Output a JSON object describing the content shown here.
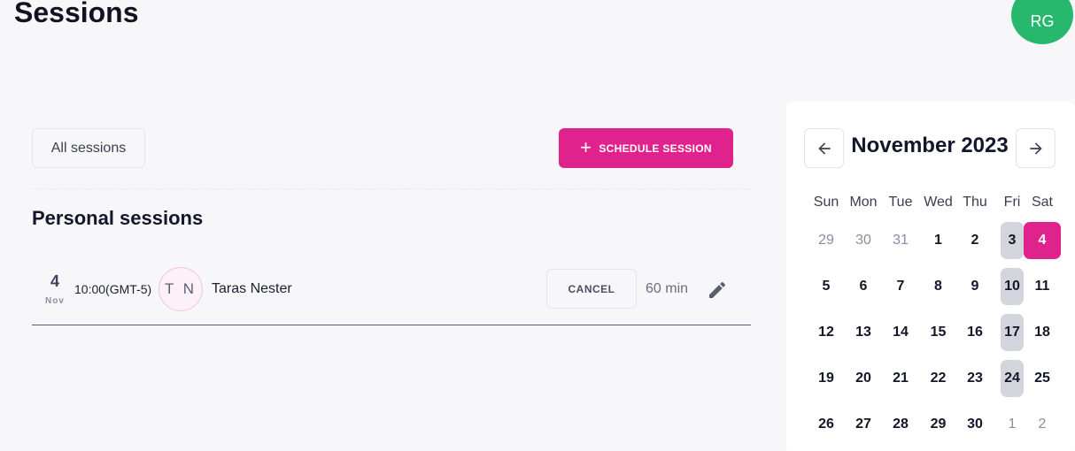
{
  "header": {
    "title": "Sessions",
    "user_initials": "RG"
  },
  "toolbar": {
    "filter_label": "All sessions",
    "schedule_label": "SCHEDULE SESSION"
  },
  "section": {
    "title": "Personal sessions"
  },
  "session": {
    "day": "4",
    "month": "Nov",
    "time": "10:00(GMT-5)",
    "initials": "T N",
    "name": "Taras Nester",
    "cancel_label": "CANCEL",
    "duration": "60 min"
  },
  "calendar": {
    "title": "November 2023",
    "weekdays": [
      "Sun",
      "Mon",
      "Tue",
      "Wed",
      "Thu",
      "Fri",
      "Sat"
    ],
    "weeks": [
      [
        "29",
        "30",
        "31",
        "1",
        "2",
        "3",
        "4"
      ],
      [
        "5",
        "6",
        "7",
        "8",
        "9",
        "10",
        "11"
      ],
      [
        "12",
        "13",
        "14",
        "15",
        "16",
        "17",
        "18"
      ],
      [
        "19",
        "20",
        "21",
        "22",
        "23",
        "24",
        "25"
      ],
      [
        "26",
        "27",
        "28",
        "29",
        "30",
        "1",
        "2"
      ]
    ],
    "selected_day": "4",
    "accent_color": "#e0228c",
    "highlight_color": "#d3d5dc"
  }
}
